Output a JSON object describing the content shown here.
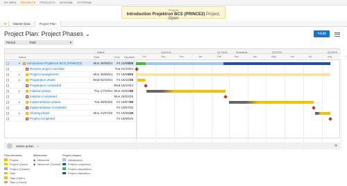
{
  "nav": {
    "items": [
      "MY AREA",
      "PROJECTS",
      "PRODUCTS",
      "INTERNAL",
      "EXTERNAL"
    ]
  },
  "banner": {
    "label": "Projects",
    "title": "Introduction Projektron BCS (PRINCE2)",
    "status": "Project, Open"
  },
  "tabs": {
    "home": "H",
    "master": "Master Data",
    "plan": "Project Plan"
  },
  "page": {
    "title": "Project Plan: Project Phases",
    "edit": "Edit"
  },
  "filter": {
    "label": "Period",
    "value": "Total"
  },
  "table": {
    "dates_header": "Dates",
    "schedule_header": "Schedule",
    "col_name": "Name",
    "col_start": "Start",
    "col_end": "End",
    "col_duration": "Duration",
    "quarters": [
      "Q4/2024",
      "Q1/2025",
      "Q2/2025",
      "Q3/2025"
    ],
    "months": [
      "Oct",
      "Nov",
      "Dec",
      "Jan",
      "Feb",
      "Mar",
      "Apr",
      "May",
      "Jun",
      "Jul",
      "Aug",
      "Sep"
    ],
    "rows": [
      {
        "name": "Introduction Projektron BCS (PRINCE2)",
        "start": "Mon 30/09/24",
        "end": "Fri 15/08/25",
        "duration": "221",
        "kind": "project",
        "expand": "▾"
      },
      {
        "name": "Receive project mandate",
        "start": "",
        "end": "Tue 01/10/24",
        "duration": "",
        "kind": "milestone",
        "expand": ""
      },
      {
        "name": "Project management",
        "start": "Mon 30/09/24",
        "end": "Fri 15/08/25",
        "duration": "221",
        "kind": "phase",
        "expand": "▸"
      },
      {
        "name": "Preparation phase",
        "start": "Wed 02/10/24",
        "end": "Fri 15/10/24",
        "duration": "15",
        "kind": "phase",
        "expand": "▸"
      },
      {
        "name": "Preparation completed",
        "start": "",
        "end": "Wed 16/10/24",
        "duration": "",
        "kind": "milestone",
        "expand": ""
      },
      {
        "name": "Initiation phase",
        "start": "Thu 17/10/24",
        "end": "Mon 24/02/25",
        "duration": "90",
        "kind": "phase",
        "expand": "▸"
      },
      {
        "name": "Initiation completed",
        "start": "",
        "end": "Mon 24/02/25",
        "duration": "",
        "kind": "milestone",
        "expand": ""
      },
      {
        "name": "Implementation phase",
        "start": "Tue 29/02/25",
        "end": "Fri 18/07/25",
        "duration": "99",
        "kind": "phase",
        "expand": "▸"
      },
      {
        "name": "Implementation completed",
        "start": "",
        "end": "Fri 18/07/25",
        "duration": "",
        "kind": "milestone",
        "expand": ""
      },
      {
        "name": "Closing phase",
        "start": "Mon 21/07/25",
        "end": "Fri 15/08/25",
        "duration": "20",
        "kind": "phase",
        "expand": "▸"
      },
      {
        "name": "Project completed",
        "start": "",
        "end": "Fri 15/08/25",
        "duration": "",
        "kind": "milestone",
        "expand": ""
      }
    ]
  },
  "footer": {
    "select_action": "Select action"
  },
  "legend": {
    "plan_elements": {
      "title": "Plan elements:",
      "items": [
        "Project",
        "Project (Open)",
        "Project (Closed)",
        "Task",
        "Task (Open)",
        "Task (Closed)"
      ]
    },
    "milestones": {
      "title": "Milestones:",
      "items": [
        "Milestone",
        "Milestone (Closed)"
      ]
    },
    "phases": {
      "title": "Project phases:",
      "items": [
        "Initialisation",
        "Project completion",
        "Project preparation",
        "Project realisation"
      ]
    }
  },
  "colors": {
    "accent": "#1a73c8",
    "project_bar": "#1f4fa8",
    "phase_bar": "#f6c200",
    "prep_bar": "#3dbd3d",
    "milestone": "#c0392b"
  }
}
